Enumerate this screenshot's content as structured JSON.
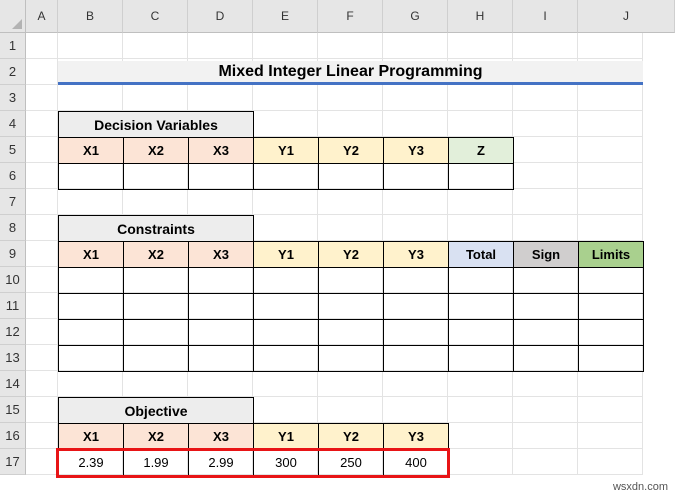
{
  "sheet": {
    "columns": [
      "A",
      "B",
      "C",
      "D",
      "E",
      "F",
      "G",
      "H",
      "I",
      "J"
    ],
    "rows": [
      "1",
      "2",
      "3",
      "4",
      "5",
      "6",
      "7",
      "8",
      "9",
      "10",
      "11",
      "12",
      "13",
      "14",
      "15",
      "16",
      "17"
    ]
  },
  "title": "Mixed Integer Linear Programming",
  "decision": {
    "label": "Decision Variables",
    "headers": [
      "X1",
      "X2",
      "X3",
      "Y1",
      "Y2",
      "Y3",
      "Z"
    ],
    "values": [
      "",
      "",
      "",
      "",
      "",
      "",
      ""
    ]
  },
  "constraints": {
    "label": "Constraints",
    "headers": [
      "X1",
      "X2",
      "X3",
      "Y1",
      "Y2",
      "Y3",
      "Total",
      "Sign",
      "Limits"
    ],
    "rows": [
      [
        "",
        "",
        "",
        "",
        "",
        "",
        "",
        "",
        ""
      ],
      [
        "",
        "",
        "",
        "",
        "",
        "",
        "",
        "",
        ""
      ],
      [
        "",
        "",
        "",
        "",
        "",
        "",
        "",
        "",
        ""
      ],
      [
        "",
        "",
        "",
        "",
        "",
        "",
        "",
        "",
        ""
      ]
    ]
  },
  "objective": {
    "label": "Objective",
    "headers": [
      "X1",
      "X2",
      "X3",
      "Y1",
      "Y2",
      "Y3"
    ],
    "values": [
      "2.39",
      "1.99",
      "2.99",
      "300",
      "250",
      "400"
    ]
  },
  "colors": {
    "x_header": "#fce4d6",
    "y_header": "#fff2cc",
    "z_header": "#e2efda",
    "total_header": "#d9e1f2",
    "sign_header": "#d0cece",
    "limits_header": "#a9d08e",
    "highlight_border": "#e81416",
    "title_underline": "#4472c4"
  },
  "watermark": "wsxdn.com"
}
